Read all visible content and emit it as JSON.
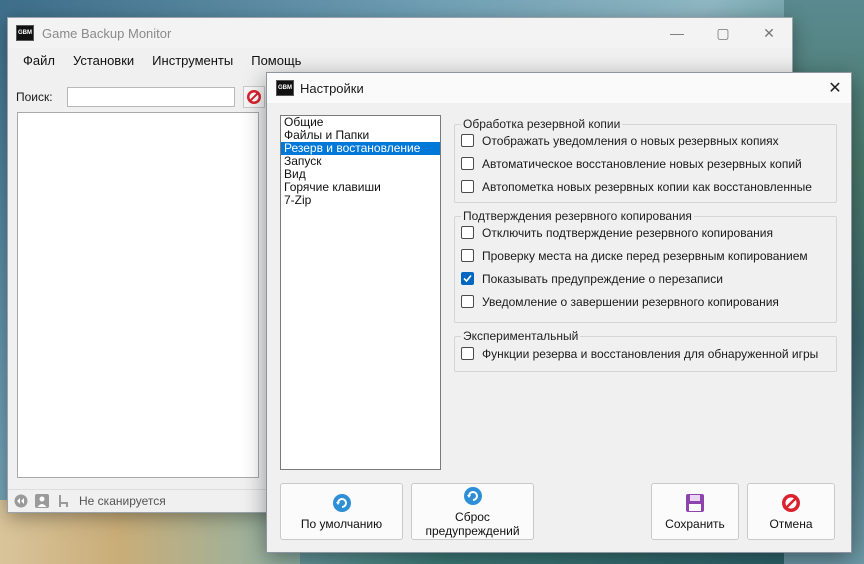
{
  "main_window": {
    "title": "Game Backup Monitor",
    "logo_text": "GBM",
    "menu": [
      "Файл",
      "Установки",
      "Инструменты",
      "Помощь"
    ],
    "search": {
      "label": "Поиск:",
      "value": ""
    },
    "status": "Не сканируется"
  },
  "settings": {
    "title": "Настройки",
    "logo_text": "GBM",
    "categories": [
      "Общие",
      "Файлы и Папки",
      "Резерв и востановление",
      "Запуск",
      "Вид",
      "Горячие клавиши",
      "7-Zip"
    ],
    "selected_category": "Резерв и востановление",
    "groups": [
      {
        "legend": "Обработка резервной копии",
        "options": [
          {
            "label": "Отображать уведомления о новых резервных копиях",
            "checked": false
          },
          {
            "label": "Автоматическое восстановление новых резервных копий",
            "checked": false
          },
          {
            "label": "Автопометка новых резервных копии как восстановленные",
            "checked": false
          }
        ]
      },
      {
        "legend": "Подтверждения резервного копирования",
        "options": [
          {
            "label": "Отключить подтверждение резервного копирования",
            "checked": false
          },
          {
            "label": "Проверку места на диске перед резервным копированием",
            "checked": false
          },
          {
            "label": "Показывать предупреждение о перезаписи",
            "checked": true
          },
          {
            "label": "Уведомление о завершении резервного копирования",
            "checked": false
          }
        ]
      },
      {
        "legend": "Экспериментальный",
        "options": [
          {
            "label": "Функции резерва и восстановления для обнаруженной игры",
            "checked": false
          }
        ]
      }
    ],
    "buttons": {
      "defaults": "По умолчанию",
      "reset_line1": "Сброс",
      "reset_line2": "предупреждений",
      "save": "Сохранить",
      "cancel": "Отмена"
    }
  },
  "colors": {
    "accent": "#0078d7",
    "checkbox_on": "#0067c0",
    "danger": "#d9232e",
    "save_icon": "#8e44ad"
  }
}
